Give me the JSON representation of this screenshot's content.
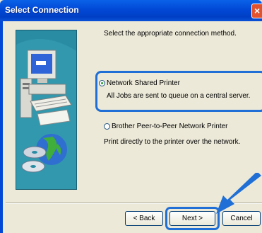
{
  "window": {
    "title": "Select Connection"
  },
  "icons": {
    "close": "close-icon",
    "illustration": "computer-globe-illustration",
    "pointer": "pointer-arrow"
  },
  "dialog": {
    "prompt": "Select the appropriate connection method.",
    "options": [
      {
        "label": "Network Shared Printer",
        "description": "All Jobs are sent to queue on a central server.",
        "selected": true
      },
      {
        "label": "Brother Peer-to-Peer Network Printer",
        "description": "Print directly to the printer over the network.",
        "selected": false
      }
    ]
  },
  "buttons": {
    "back": "< Back",
    "next": "Next >",
    "cancel": "Cancel"
  },
  "colors": {
    "titlebar": "#0148d6",
    "highlight": "#1f6fd6",
    "dialog_bg": "#ece9d8"
  }
}
